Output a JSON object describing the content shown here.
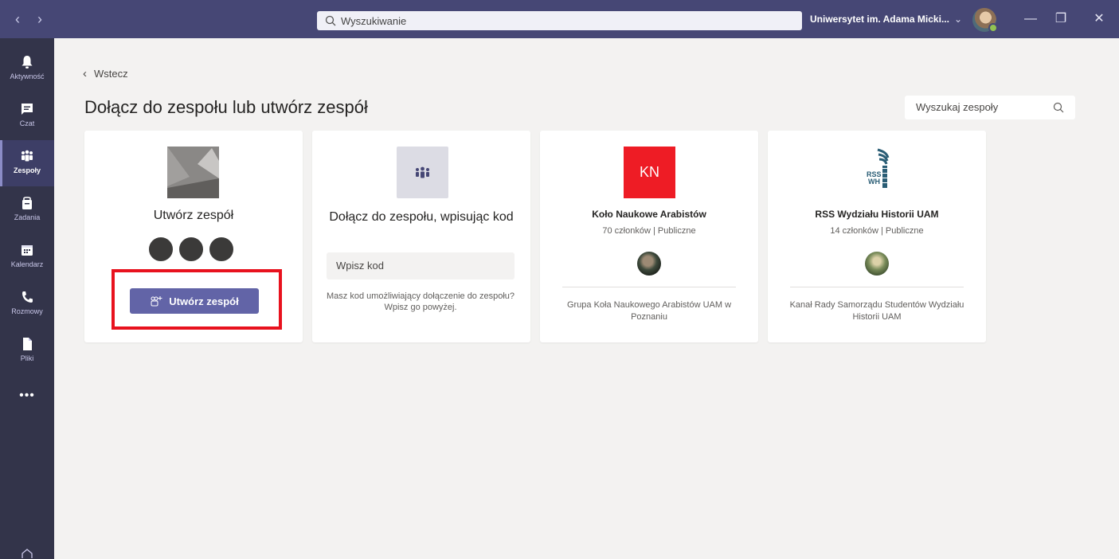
{
  "titlebar": {
    "search_placeholder": "Wyszukiwanie",
    "org_name": "Uniwersytet im. Adama Micki...",
    "org_chevron": "⌄",
    "back_arrow": "‹",
    "forward_arrow": "›",
    "minimize": "—",
    "maximize": "❐",
    "close": "✕"
  },
  "rail": {
    "items": [
      {
        "label": "Aktywność",
        "icon": "bell-icon"
      },
      {
        "label": "Czat",
        "icon": "chat-icon"
      },
      {
        "label": "Zespoły",
        "icon": "teams-icon"
      },
      {
        "label": "Zadania",
        "icon": "assignments-icon"
      },
      {
        "label": "Kalendarz",
        "icon": "calendar-icon"
      },
      {
        "label": "Rozmowy",
        "icon": "phone-icon"
      },
      {
        "label": "Pliki",
        "icon": "file-icon"
      }
    ],
    "more": "•••"
  },
  "main": {
    "back_label": "Wstecz",
    "title": "Dołącz do zespołu lub utwórz zespół",
    "team_search_placeholder": "Wyszukaj zespoły"
  },
  "cards": {
    "create": {
      "name": "Utwórz zespół",
      "button_label": "Utwórz zespół"
    },
    "join": {
      "title": "Dołącz do zespołu, wpisując kod",
      "input_placeholder": "Wpisz kod",
      "help": "Masz kod umożliwiający dołączenie do zespołu? Wpisz go powyżej."
    },
    "team1": {
      "logo_text": "KN",
      "name": "Koło Naukowe Arabistów",
      "meta": "70 członków | Publiczne",
      "description": "Grupa Koła Naukowego Arabistów UAM w Poznaniu"
    },
    "team2": {
      "logo_text": "RSS WH",
      "name": "RSS Wydziału Historii UAM",
      "meta": "14 członków | Publiczne",
      "description": "Kanał Rady Samorządu Studentów Wydziału Historii UAM"
    }
  },
  "colors": {
    "titlebar": "#464775",
    "rail": "#33344a",
    "accent": "#6264a7",
    "highlight": "#e8121e",
    "kn_logo": "#ee1c25"
  }
}
